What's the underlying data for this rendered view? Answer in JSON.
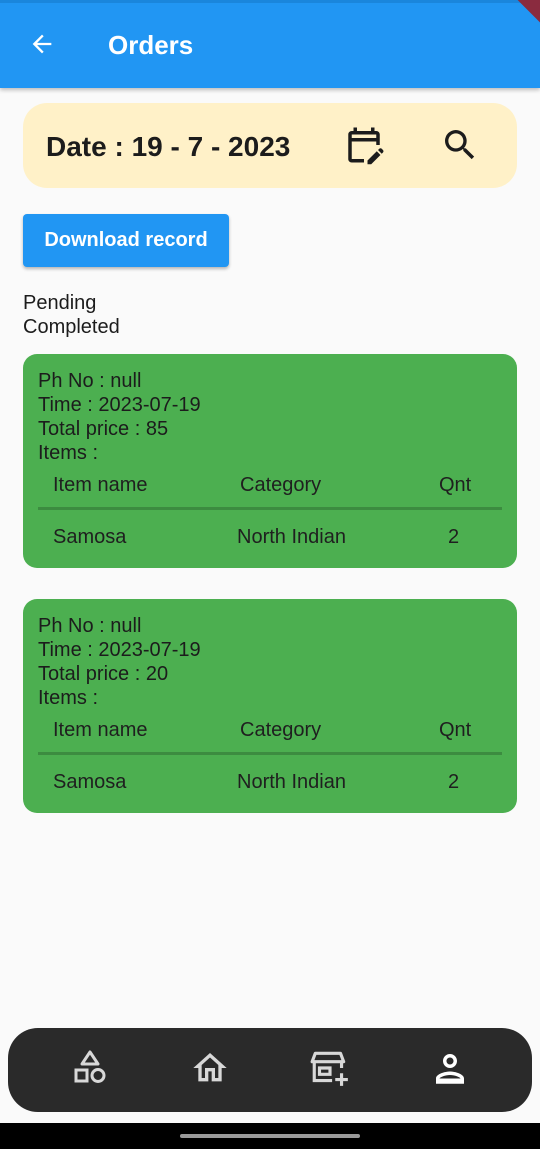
{
  "app_bar": {
    "title": "Orders",
    "color": "#2196f3"
  },
  "date_filter": {
    "label": "Date : 19 - 7 - 2023",
    "background": "#fff1c8",
    "calendar_icon": "calendar-edit-icon",
    "search_icon": "search-icon"
  },
  "download_button": {
    "label": "Download record"
  },
  "status_filters": {
    "pending": "Pending",
    "completed": "Completed"
  },
  "orders": [
    {
      "phone": "Ph No : null",
      "time": "Time : 2023-07-19",
      "total": "Total price : 85",
      "items_label": "Items :",
      "columns": [
        "Item name",
        "Category",
        "Qnt"
      ],
      "rows": [
        {
          "name": "Samosa",
          "category": "North Indian",
          "qnt": "2"
        }
      ]
    },
    {
      "phone": "Ph No : null",
      "time": "Time : 2023-07-19",
      "total": "Total price : 20",
      "items_label": "Items :",
      "columns": [
        "Item name",
        "Category",
        "Qnt"
      ],
      "rows": [
        {
          "name": "Samosa",
          "category": "North Indian",
          "qnt": "2"
        }
      ]
    }
  ],
  "order_card_color": "#4caf50",
  "bottom_nav": {
    "items": [
      "shapes-icon",
      "home-icon",
      "add-store-icon",
      "person-icon"
    ]
  }
}
